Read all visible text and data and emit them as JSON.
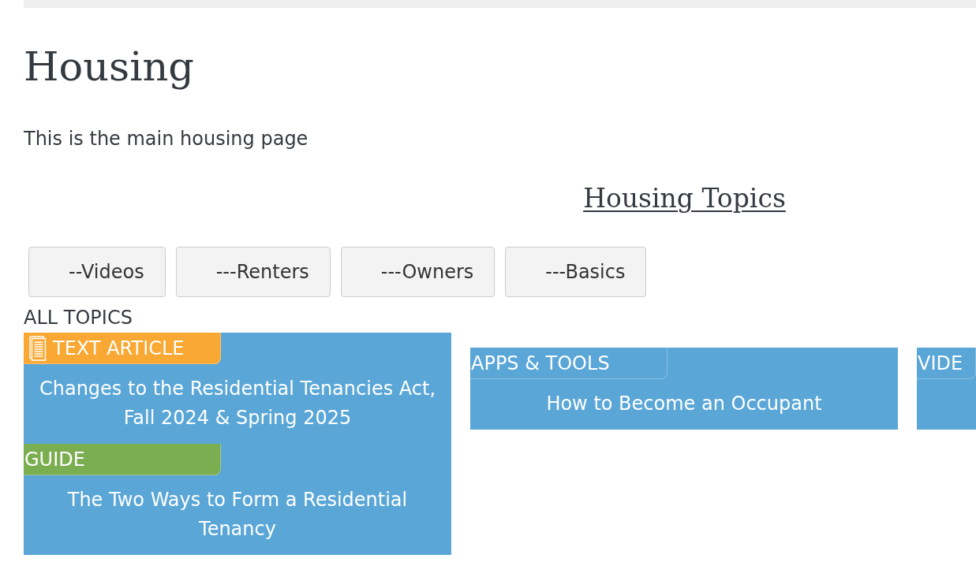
{
  "page": {
    "title": "Housing",
    "intro": "This is the main housing page"
  },
  "topics_heading": "Housing Topics",
  "filter_buttons": [
    {
      "label": "--Videos"
    },
    {
      "label": "---Renters"
    },
    {
      "label": "---Owners"
    },
    {
      "label": "---Basics"
    }
  ],
  "all_topics_label": "ALL TOPICS",
  "cards": [
    {
      "items": [
        {
          "tag": {
            "label": "TEXT ARTICLE",
            "kind": "article",
            "color": "#f9a833"
          },
          "title": "Changes to the Residential Tenancies Act, Fall 2024 & Spring 2025"
        },
        {
          "tag": {
            "label": "GUIDE",
            "kind": "guide",
            "color": "#7aae50"
          },
          "title": "The Two Ways to Form a Residential Tenancy"
        }
      ]
    },
    {
      "items": [
        {
          "tag": {
            "label": "APPS & TOOLS",
            "kind": "tool",
            "color": "#59a6d7"
          },
          "title": "How to Become an Occupant"
        }
      ]
    },
    {
      "items": [
        {
          "tag": {
            "label": "VIDE",
            "kind": "video",
            "color": "#59a6d7"
          }
        }
      ]
    }
  ]
}
